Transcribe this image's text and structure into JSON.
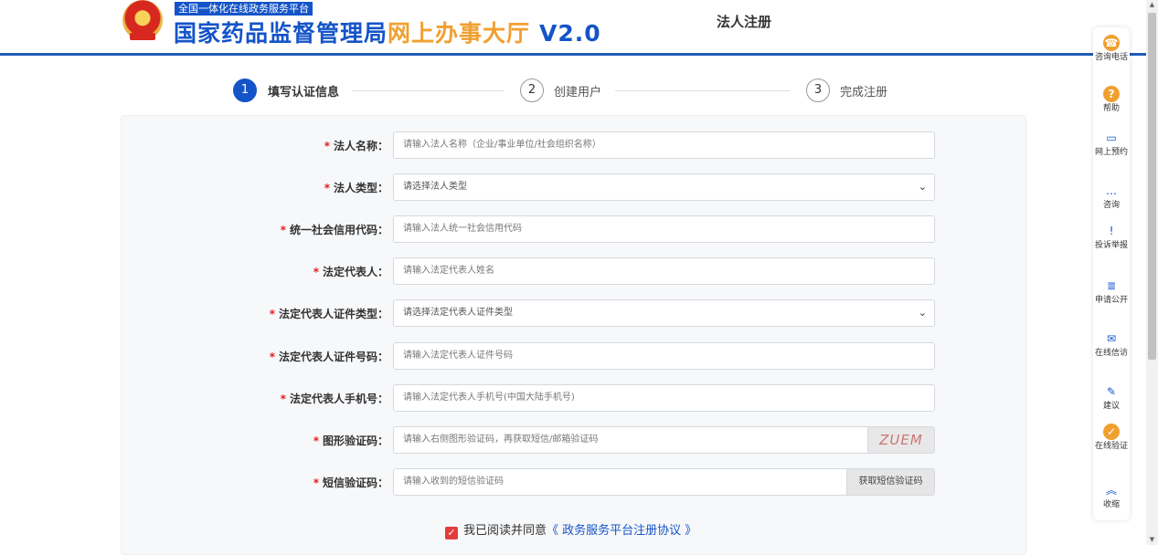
{
  "header": {
    "tag": "全国一体化在线政务服务平台",
    "title_blue": "国家药品监督管理局",
    "title_orange": "网上办事大厅",
    "version": "V2.0",
    "page_heading": "法人注册"
  },
  "steps": [
    {
      "num": "1",
      "label": "填写认证信息"
    },
    {
      "num": "2",
      "label": "创建用户"
    },
    {
      "num": "3",
      "label": "完成注册"
    }
  ],
  "form": {
    "required_mark": "*",
    "fields": [
      {
        "label": "法人名称：",
        "placeholder": "请输入法人名称（企业/事业单位/社会组织名称）"
      },
      {
        "label": "法人类型：",
        "placeholder": "请选择法人类型"
      },
      {
        "label": "统一社会信用代码：",
        "placeholder": "请输入法人统一社会信用代码"
      },
      {
        "label": "法定代表人：",
        "placeholder": "请输入法定代表人姓名"
      },
      {
        "label": "法定代表人证件类型：",
        "placeholder": "请选择法定代表人证件类型"
      },
      {
        "label": "法定代表人证件号码：",
        "placeholder": "请输入法定代表人证件号码"
      },
      {
        "label": "法定代表人手机号：",
        "placeholder": "请输入法定代表人手机号(中国大陆手机号)"
      },
      {
        "label": "图形验证码：",
        "placeholder": "请输入右侧图形验证码，再获取短信/邮箱验证码"
      },
      {
        "label": "短信验证码：",
        "placeholder": "请输入收到的短信验证码"
      }
    ],
    "captcha_text": "ZUEM",
    "sms_button": "获取短信验证码",
    "agree_text": "我已阅读并同意",
    "agree_link": "《 政务服务平台注册协议 》",
    "select_caret": "⌄",
    "check_mark": "✓"
  },
  "sidebar": [
    {
      "label": "咨询电话",
      "icon": "phone-icon",
      "glyph": "☎"
    },
    {
      "label": "帮助",
      "icon": "help-icon",
      "glyph": "?"
    },
    {
      "label": "网上预约",
      "icon": "monitor-icon",
      "glyph": "▭"
    },
    {
      "label": "咨询",
      "icon": "chat-icon",
      "glyph": "…"
    },
    {
      "label": "投诉举报",
      "icon": "shield-icon",
      "glyph": "!"
    },
    {
      "label": "申请公开",
      "icon": "document-icon",
      "glyph": "≣"
    },
    {
      "label": "在线信访",
      "icon": "mail-icon",
      "glyph": "✉"
    },
    {
      "label": "建议",
      "icon": "edit-icon",
      "glyph": "✎"
    },
    {
      "label": "在线验证",
      "icon": "verify-icon",
      "glyph": "✓"
    },
    {
      "label": "收缩",
      "icon": "collapse-icon",
      "glyph": "︽"
    }
  ],
  "colors": {
    "primary": "#1554c8",
    "orange": "#f0a030",
    "required": "#e02020"
  }
}
